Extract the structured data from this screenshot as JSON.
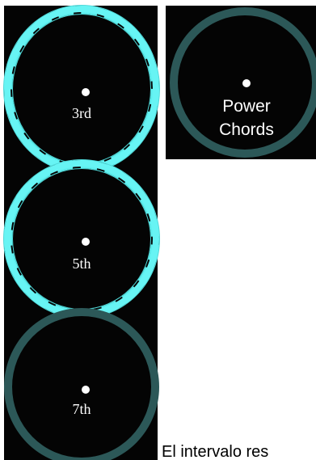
{
  "rings": {
    "third": {
      "label": "3rd",
      "state": "active"
    },
    "fifth": {
      "label": "5th",
      "state": "active"
    },
    "seventh": {
      "label": "7th",
      "state": "inactive"
    }
  },
  "power_chords": {
    "line1": "Power",
    "line2": "Chords",
    "state": "inactive"
  },
  "caption": "El intervalo res",
  "colors": {
    "active_ring": "#5ef0f0",
    "inactive_ring": "#2c5858",
    "panel_background": "#040404"
  }
}
